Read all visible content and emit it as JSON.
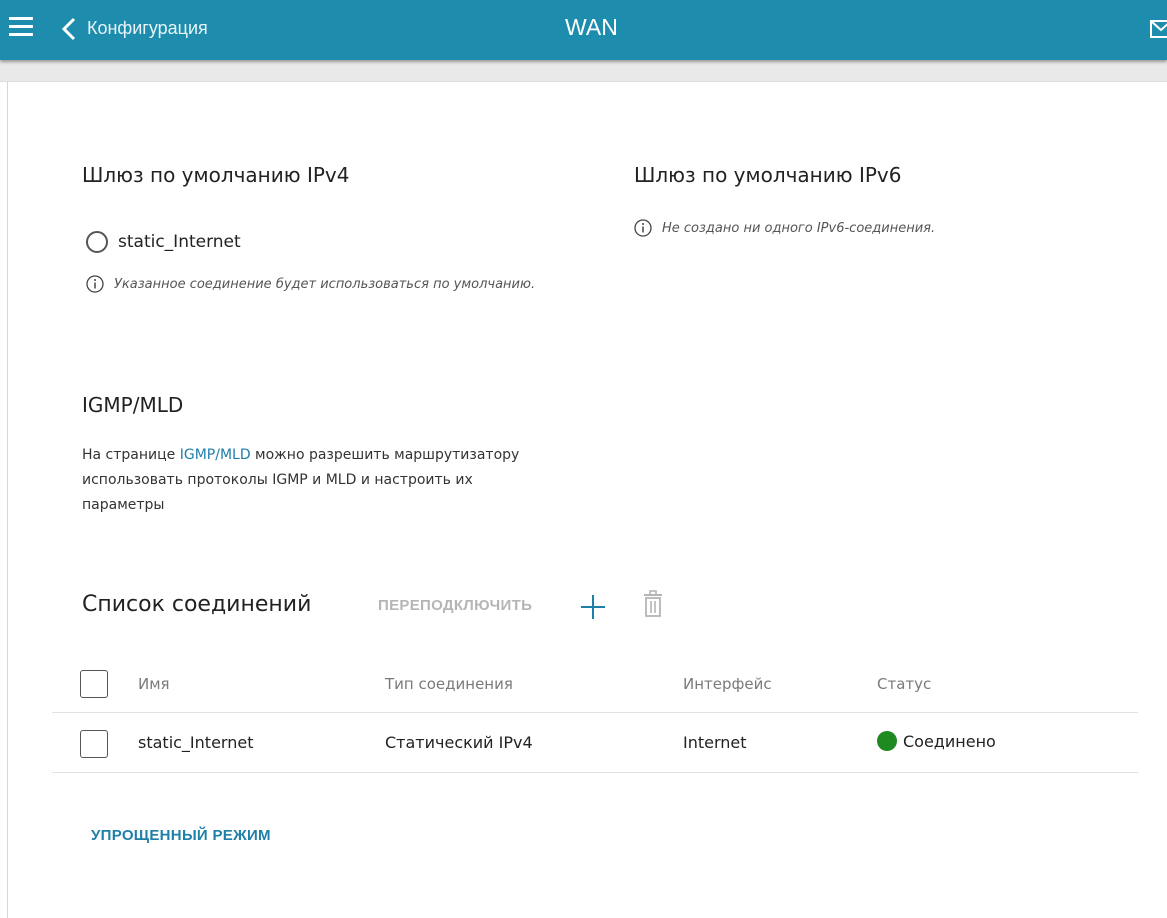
{
  "header": {
    "back_label": "Конфигурация",
    "title": "WAN",
    "bar_color": "#1e8cad",
    "icons": [
      "menu-icon",
      "chevron-left-icon",
      "mail-icon"
    ]
  },
  "ipv4": {
    "title": "Шлюз по умолчанию IPv4",
    "radio_option": "static_Internet",
    "radio_selected": false,
    "hint": "Указанное соединение будет использоваться по умолчанию."
  },
  "ipv6": {
    "title": "Шлюз по умолчанию IPv6",
    "hint": "Не создано ни одного IPv6-соединения."
  },
  "igmp": {
    "title": "IGMP/MLD",
    "text_before": "На странице ",
    "link": "IGMP/MLD",
    "text_after": " можно разрешить маршрутизатору использовать протоколы IGMP и MLD и настроить их параметры"
  },
  "connections": {
    "title": "Список соединений",
    "reconnect_label": "ПЕРЕПОДКЛЮЧИТЬ",
    "columns": [
      "Имя",
      "Тип соединения",
      "Интерфейс",
      "Статус"
    ],
    "rows": [
      {
        "name": "static_Internet",
        "type": "Статический IPv4",
        "interface": "Internet",
        "status": "Соединено",
        "status_color": "#1f8a1f",
        "checked": false
      }
    ]
  },
  "footer": {
    "simple_mode_label": "УПРОЩЕННЫЙ РЕЖИМ"
  }
}
